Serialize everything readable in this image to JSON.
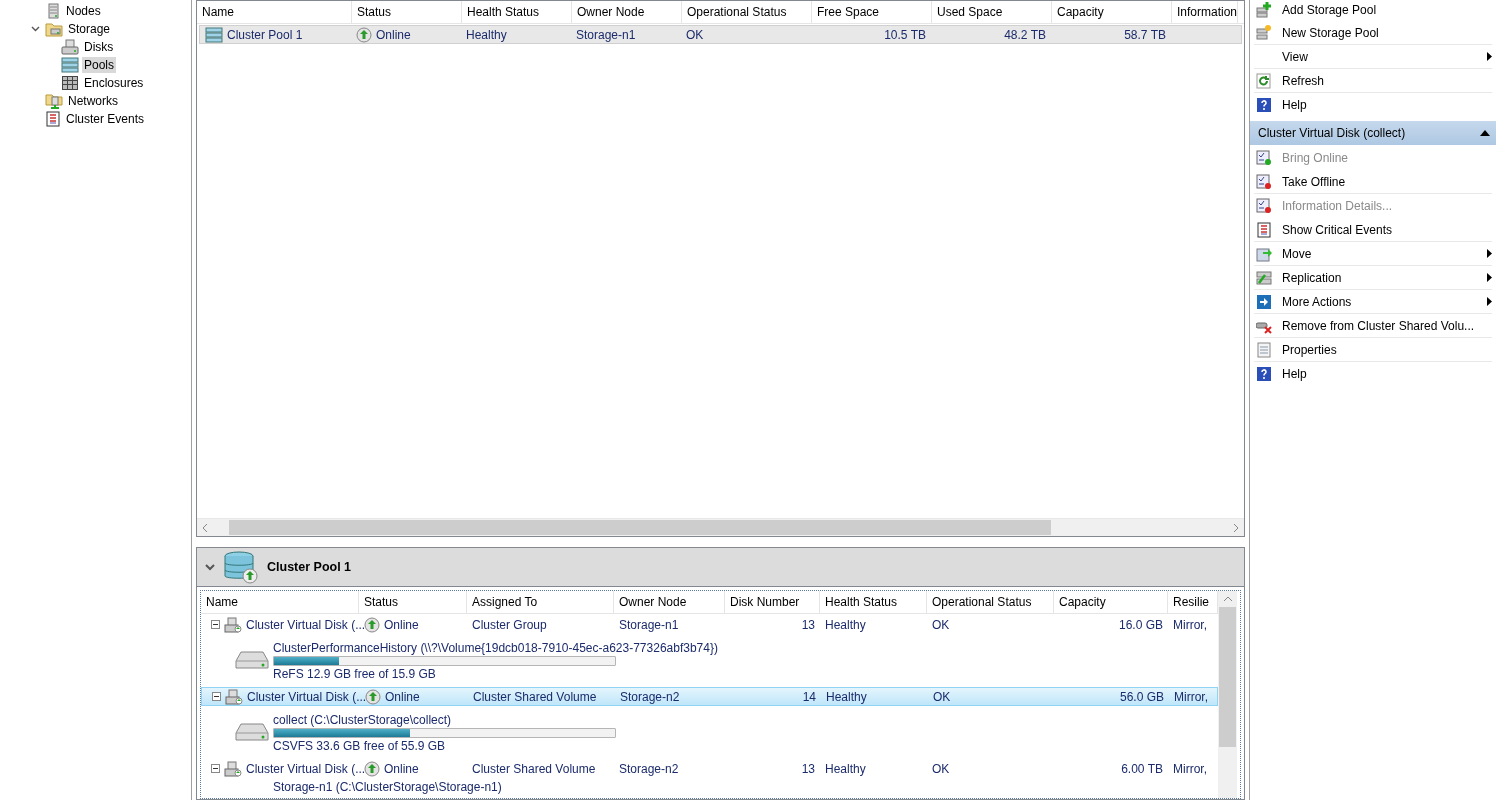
{
  "tree": {
    "items": [
      {
        "label": "Nodes",
        "selected": false
      },
      {
        "label": "Storage",
        "selected": false,
        "expanded": true,
        "children": [
          {
            "label": "Disks",
            "selected": false
          },
          {
            "label": "Pools",
            "selected": true
          },
          {
            "label": "Enclosures",
            "selected": false
          }
        ]
      },
      {
        "label": "Networks",
        "selected": false
      },
      {
        "label": "Cluster Events",
        "selected": false
      }
    ]
  },
  "pools_table": {
    "columns": [
      "Name",
      "Status",
      "Health Status",
      "Owner Node",
      "Operational Status",
      "Free Space",
      "Used Space",
      "Capacity",
      "Information"
    ],
    "rows": [
      {
        "selected": true,
        "cells": [
          "Cluster Pool 1",
          "Online",
          "Healthy",
          "Storage-n1",
          "OK",
          "10.5 TB",
          "48.2 TB",
          "58.7 TB",
          ""
        ]
      }
    ]
  },
  "details": {
    "title": "Cluster Pool 1",
    "expanded": true,
    "columns": [
      "Name",
      "Status",
      "Assigned To",
      "Owner Node",
      "Disk Number",
      "Health Status",
      "Operational Status",
      "Capacity",
      "Resilie"
    ],
    "rows": [
      {
        "selected": false,
        "expanded": true,
        "cells": [
          "Cluster Virtual Disk (...",
          "Online",
          "Cluster Group",
          "Storage-n1",
          "13",
          "Healthy",
          "OK",
          "16.0 GB",
          "Mirror,"
        ],
        "volume": {
          "name": "ClusterPerformanceHistory (\\\\?\\Volume{19dcb018-7910-45ec-a623-77326abf3b74})",
          "level": 0.19,
          "usage": "ReFS 12.9 GB free of 15.9 GB"
        }
      },
      {
        "selected": true,
        "expanded": true,
        "cells": [
          "Cluster Virtual Disk (...",
          "Online",
          "Cluster Shared Volume",
          "Storage-n2",
          "14",
          "Healthy",
          "OK",
          "56.0 GB",
          "Mirror,"
        ],
        "volume": {
          "name": "collect (C:\\ClusterStorage\\collect)",
          "level": 0.4,
          "usage": "CSVFS 33.6 GB free of 55.9 GB"
        }
      },
      {
        "selected": false,
        "expanded": true,
        "cells": [
          "Cluster Virtual Disk (...",
          "Online",
          "Cluster Shared Volume",
          "Storage-n2",
          "13",
          "Healthy",
          "OK",
          "6.00 TB",
          "Mirror,"
        ],
        "volume": {
          "name": "Storage-n1 (C:\\ClusterStorage\\Storage-n1)"
        }
      }
    ]
  },
  "actions": {
    "top_items": [
      {
        "label": "Add Storage Pool",
        "disabled": false,
        "submenu": false
      },
      {
        "label": "New Storage Pool",
        "disabled": false,
        "submenu": false
      },
      {
        "label": "View",
        "disabled": false,
        "submenu": true
      },
      {
        "label": "Refresh",
        "disabled": false,
        "submenu": false
      },
      {
        "label": "Help",
        "disabled": false,
        "submenu": false
      }
    ],
    "section": {
      "title": "Cluster Virtual Disk (collect)",
      "expanded": true,
      "items": [
        {
          "label": "Bring Online",
          "disabled": true,
          "submenu": false
        },
        {
          "label": "Take Offline",
          "disabled": false,
          "submenu": false
        },
        {
          "label": "Information Details...",
          "disabled": true,
          "submenu": false
        },
        {
          "label": "Show Critical Events",
          "disabled": false,
          "submenu": false
        },
        {
          "label": "Move",
          "disabled": false,
          "submenu": true
        },
        {
          "label": "Replication",
          "disabled": false,
          "submenu": true
        },
        {
          "label": "More Actions",
          "disabled": false,
          "submenu": true
        },
        {
          "label": "Remove from Cluster Shared Volu...",
          "disabled": false,
          "submenu": false
        },
        {
          "label": "Properties",
          "disabled": false,
          "submenu": false
        },
        {
          "label": "Help",
          "disabled": false,
          "submenu": false
        }
      ]
    }
  }
}
